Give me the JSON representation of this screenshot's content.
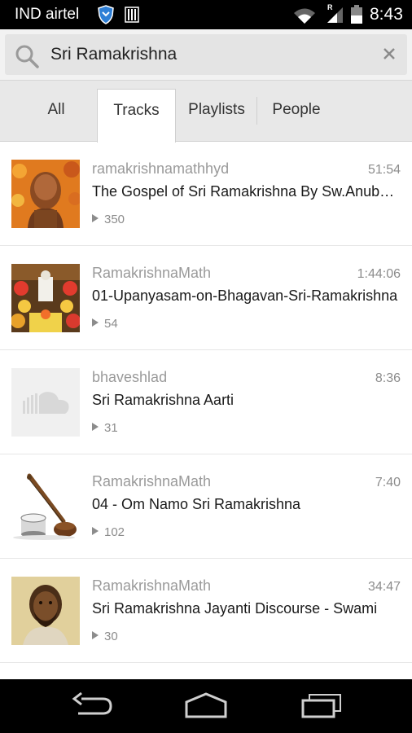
{
  "status_bar": {
    "carrier": "IND airtel",
    "roaming": "R",
    "time": "8:43"
  },
  "search": {
    "value": "Sri Ramakrishna",
    "placeholder": ""
  },
  "tabs": [
    {
      "label": "All"
    },
    {
      "label": "Tracks",
      "active": true
    },
    {
      "label": "Playlists"
    },
    {
      "label": "People"
    }
  ],
  "tracks": [
    {
      "uploader": "ramakrishnamathhyd",
      "duration": "51:54",
      "title": "The Gospel of Sri Ramakrishna By Sw.Anubhavananda",
      "plays": "350",
      "thumbnail": "bronze-bust"
    },
    {
      "uploader": "RamakrishnaMath",
      "duration": "1:44:06",
      "title": "01-Upanyasam-on-Bhagavan-Sri-Ramakrishna",
      "plays": "54",
      "thumbnail": "flower-altar"
    },
    {
      "uploader": "bhaveshlad",
      "duration": "8:36",
      "title": "Sri Ramakrishna Aarti",
      "plays": "31",
      "thumbnail": "soundcloud-placeholder"
    },
    {
      "uploader": "RamakrishnaMath",
      "duration": "7:40",
      "title": "04 - Om Namo Sri Ramakrishna",
      "plays": "102",
      "thumbnail": "sitar-tabla"
    },
    {
      "uploader": "RamakrishnaMath",
      "duration": "34:47",
      "title": "Sri Ramakrishna Jayanti Discourse - Swami",
      "plays": "30",
      "thumbnail": "portrait"
    }
  ],
  "nav": {
    "back": "back-icon",
    "home": "home-icon",
    "recents": "recents-icon"
  }
}
